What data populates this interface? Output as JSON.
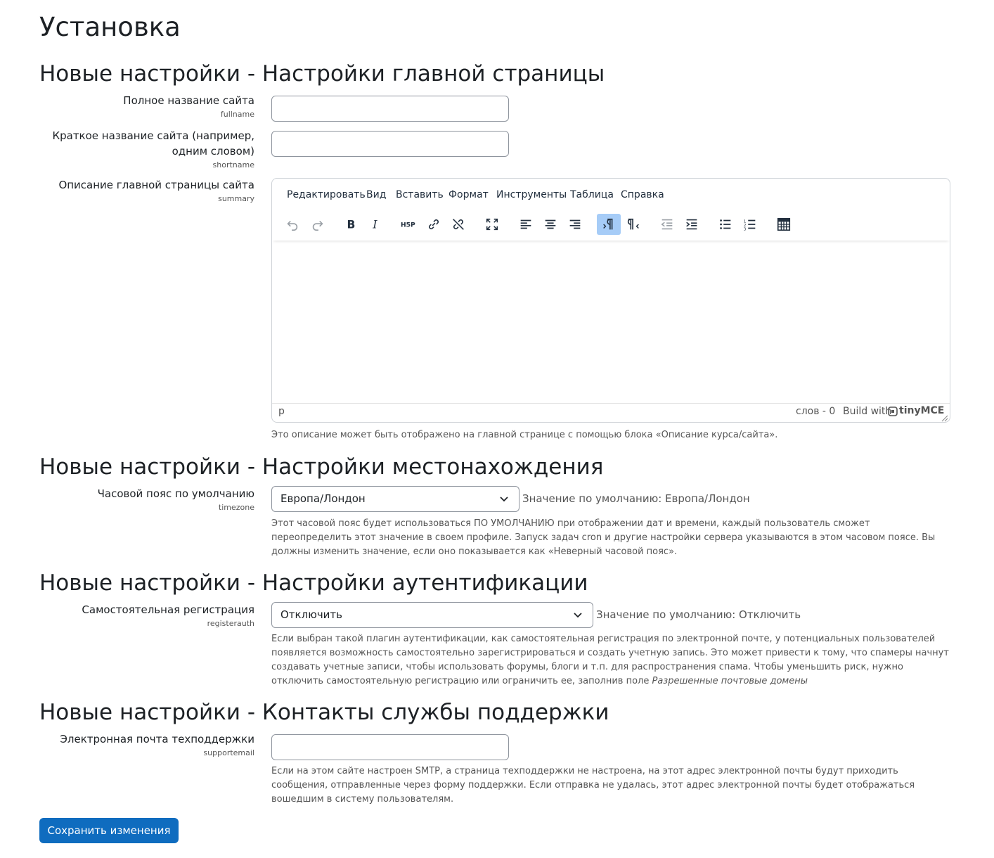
{
  "page": {
    "title": "Установка"
  },
  "colors": {
    "primary": "#0f6cbf",
    "text": "#1d2125",
    "muted": "#555555",
    "active_tool": "#a6ccf7"
  },
  "sections": [
    {
      "heading": "Новые настройки - Настройки главной страницы"
    },
    {
      "heading": "Новые настройки - Настройки местонахождения"
    },
    {
      "heading": "Новые настройки - Настройки аутентификации"
    },
    {
      "heading": "Новые настройки - Контакты службы поддержки"
    }
  ],
  "fullname": {
    "label": "Полное название сайта",
    "name": "fullname",
    "value": ""
  },
  "shortname": {
    "label_line1": "Краткое название сайта (например,",
    "label_line2": "одним словом)",
    "name": "shortname",
    "value": ""
  },
  "summary": {
    "label": "Описание главной страницы сайта",
    "name": "summary",
    "description": "Это описание может быть отображено на главной странице с помощью блока «Описание курса/сайта»."
  },
  "editor": {
    "menu": [
      "Редактировать",
      "Вид",
      "Вставить",
      "Формат",
      "Инструменты",
      "Таблица",
      "Справка"
    ],
    "toolbar_icons": [
      "undo-icon",
      "redo-icon",
      "bold-icon",
      "italic-icon",
      "h5p-icon",
      "link-icon",
      "unlink-icon",
      "fullscreen-icon",
      "align-left-icon",
      "align-center-icon",
      "align-right-icon",
      "ltr-icon",
      "rtl-icon",
      "outdent-icon",
      "indent-icon",
      "bullet-list-icon",
      "numbered-list-icon",
      "calculator-icon"
    ],
    "status_path": "p",
    "word_count": "слов - 0",
    "build_with": "Build with",
    "brand": "tinyMCE"
  },
  "timezone": {
    "label": "Часовой пояс по умолчанию",
    "name": "timezone",
    "selected": "Европа/Лондон",
    "default_text": "Значение по умолчанию: Европа/Лондон",
    "description": "Этот часовой пояс будет использоваться ПО УМОЛЧАНИЮ при отображении дат и времени, каждый пользователь сможет переопределить этот значение в своем профиле. Запуск задач cron и другие настройки сервера указываются в этом часовом поясе. Вы должны изменить значение, если оно показывается как «Неверный часовой пояс»."
  },
  "registerauth": {
    "label": "Самостоятельная регистрация",
    "name": "registerauth",
    "selected": "Отключить",
    "default_text": "Значение по умолчанию: Отключить",
    "description": "Если выбран такой плагин аутентификации, как самостоятельная регистрация по электронной почте, у потенциальных пользователей появляется возможность самостоятельно зарегистрироваться и создать учетную запись. Это может привести к тому, что спамеры начнут создавать учетные записи, чтобы использовать форумы, блоги и т.п. для распространения спама. Чтобы уменьшить риск, нужно отключить самостоятельную регистрацию или ограничить ее, заполнив поле",
    "description_em": "Разрешенные почтовые домены"
  },
  "supportemail": {
    "label": "Электронная почта техподдержки",
    "name": "supportemail",
    "value": "",
    "description": "Если на этом сайте настроен SMTP, а страница техподдержки не настроена, на этот адрес электронной почты будут приходить сообщения, отправленные через форму поддержки. Если отправка не удалась, этот адрес электронной почты будет отображаться вошедшим в систему пользователям."
  },
  "actions": {
    "save": "Сохранить изменения"
  }
}
